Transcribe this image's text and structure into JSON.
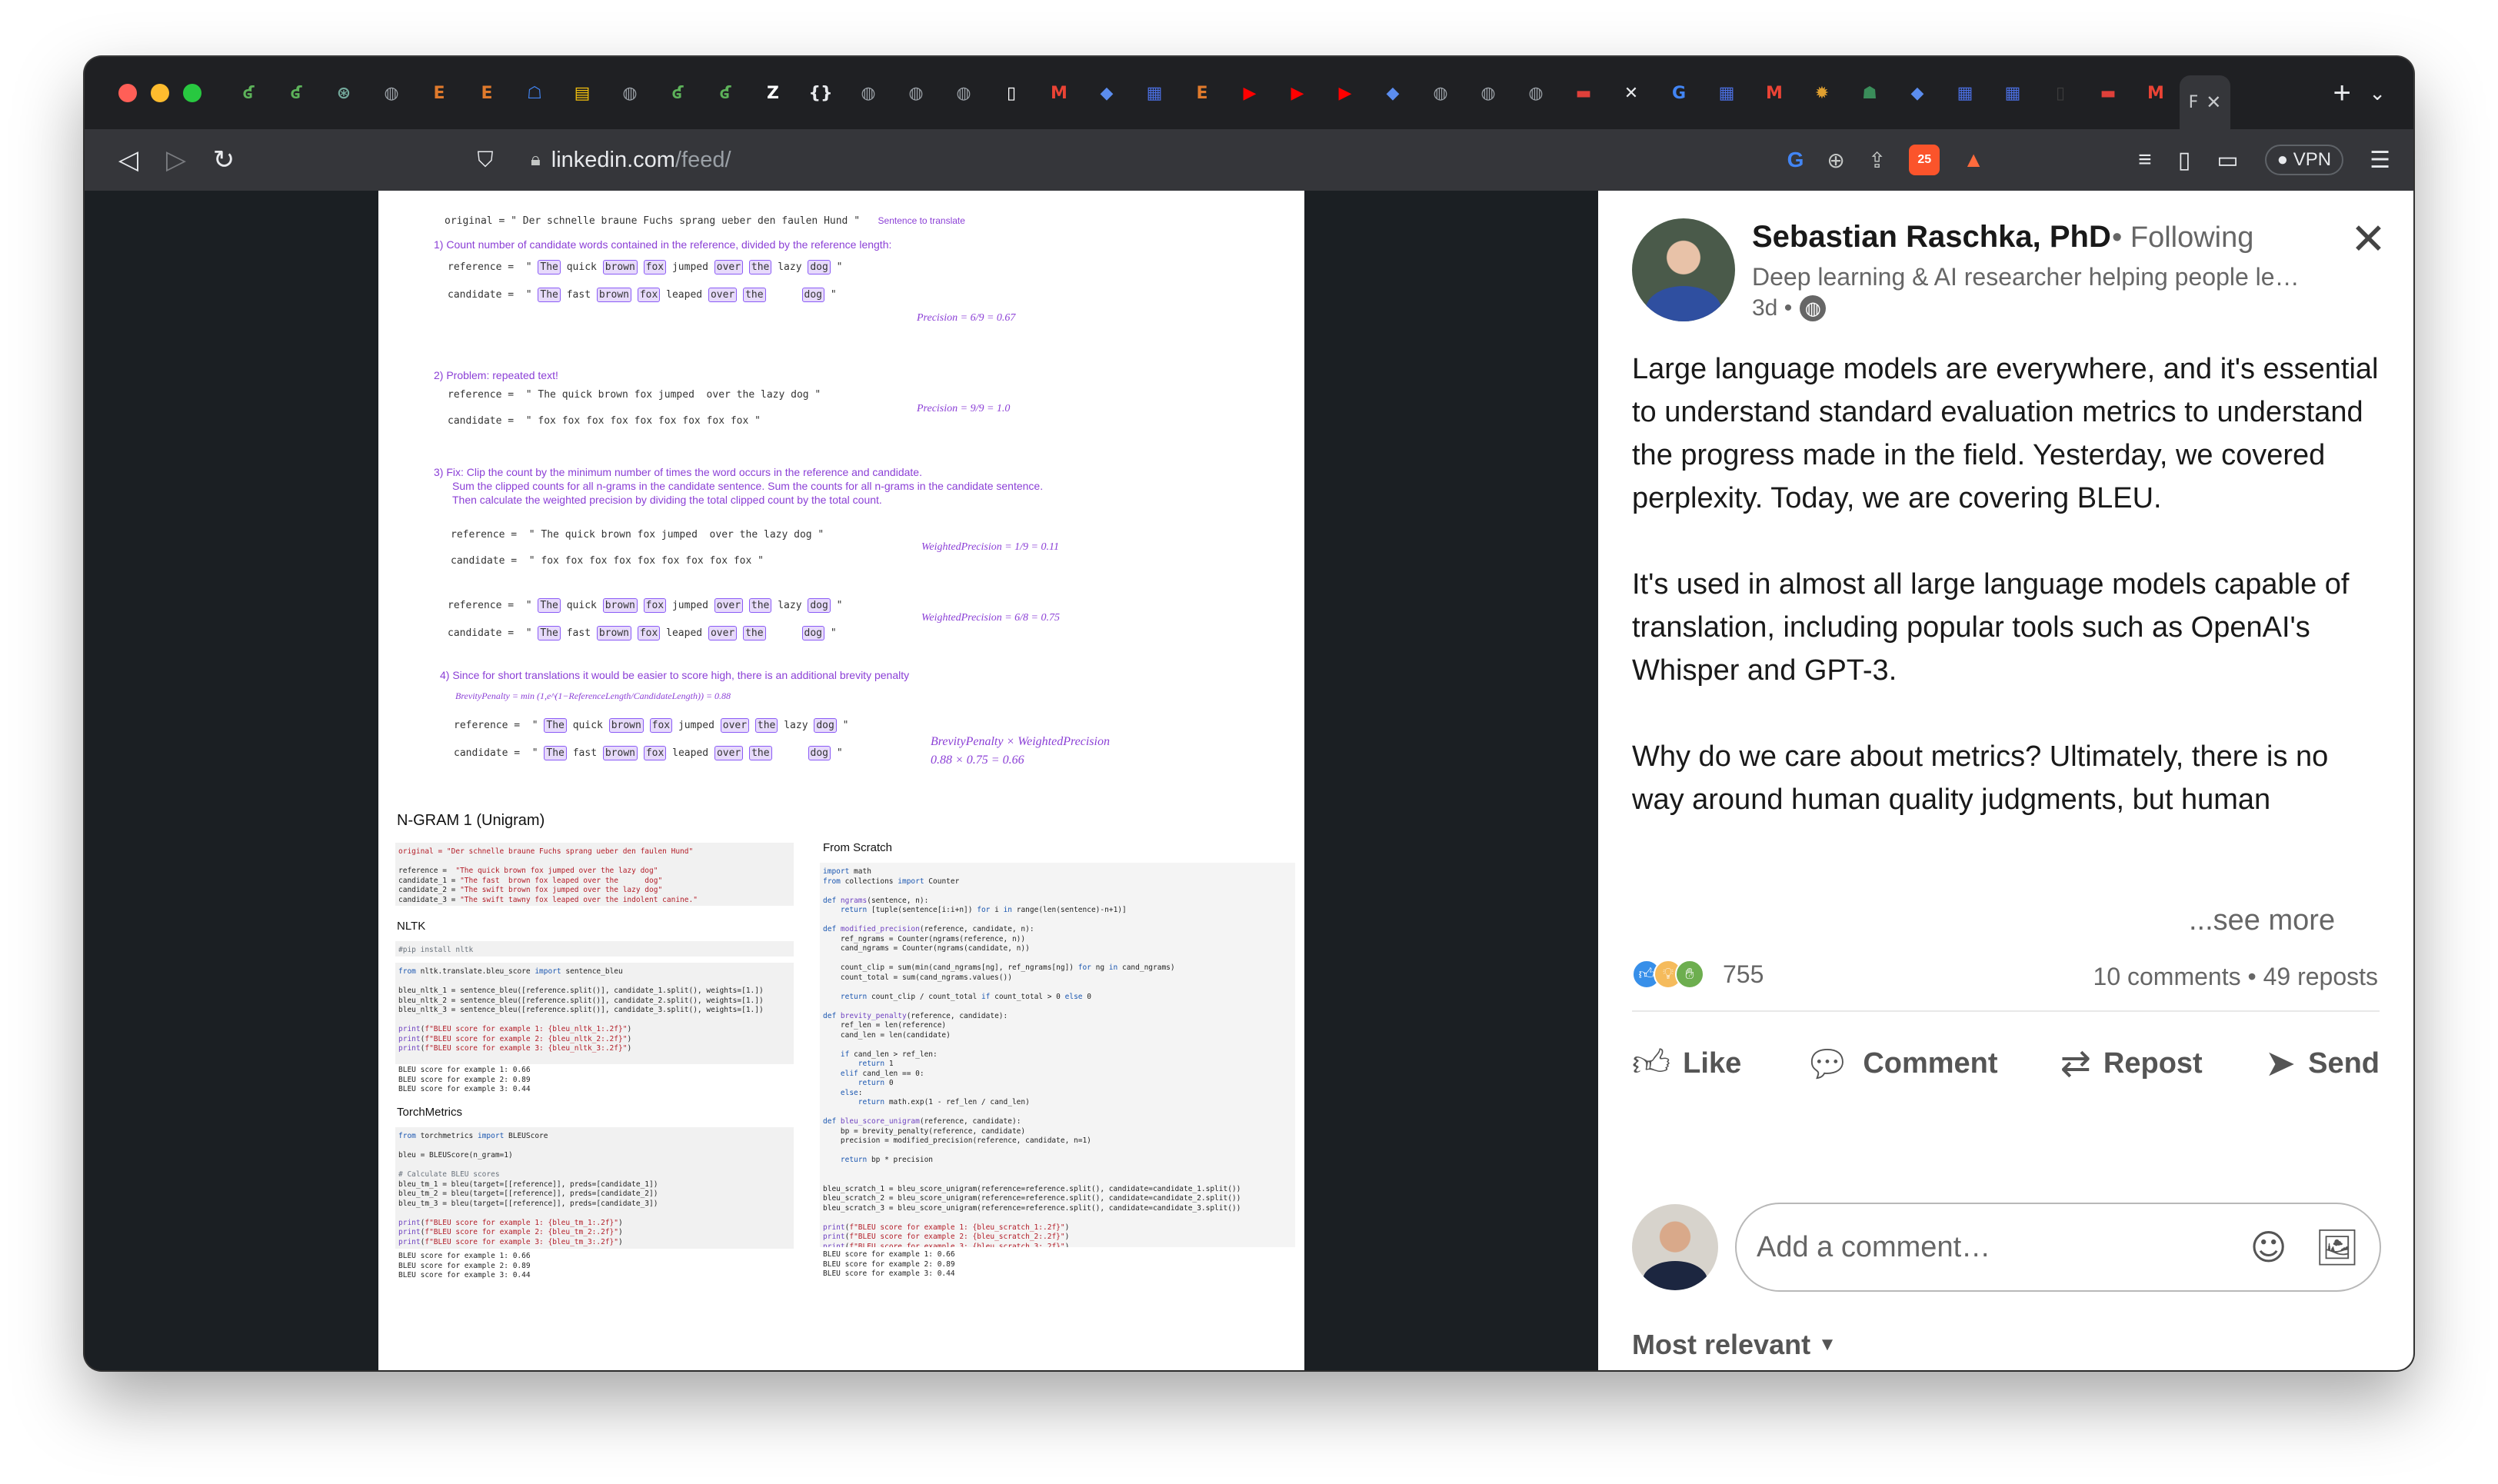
{
  "browser": {
    "tabs": [
      "ʛ",
      "ʛ",
      "⊛",
      "◍",
      "E",
      "E",
      "☖",
      "▤",
      "◍",
      "ʛ",
      "ʛ",
      "Z",
      "{}",
      "◍",
      "◍",
      "◍",
      "▯",
      "M",
      "◆",
      "▦",
      "E",
      "▶",
      "▶",
      "▶",
      "◆",
      "◍",
      "◍",
      "◍",
      "▬",
      "✕",
      "G",
      "▦",
      "M",
      "✹",
      "☗",
      "◆",
      "▦",
      "▦",
      "▯",
      "▬",
      "M"
    ],
    "active_tab_label": "F",
    "url_host": "linkedin.com",
    "url_path": "/feed/",
    "brave_badge": "25",
    "vpn_label": "VPN"
  },
  "figure": {
    "original_line": "original = \" Der schnelle braune Fuchs sprang ueber den faulen Hund \"",
    "original_note": "Sentence to translate",
    "step1": "1) Count number of candidate words contained in the reference, divided by the reference length:",
    "ref_label": "reference =",
    "cand_label": "candidate =",
    "precision1": "Precision = 6/9 = 0.67",
    "step2": "2) Problem: repeated text!",
    "ref_sentence": "\" The quick brown fox jumped  over the lazy dog \"",
    "cand_repeat": "\" fox fox fox fox fox fox fox fox fox \"",
    "precision2": "Precision = 9/9 = 1.0",
    "step3a": "3) Fix: Clip the count by the minimum number of times the word occurs in the reference and candidate.",
    "step3b": "Sum the clipped counts for all n-grams in the candidate sentence. Sum the counts for all n-grams in the candidate sentence.",
    "step3c": "Then calculate the weighted precision by dividing the total clipped count by the total count.",
    "wprec1": "WeightedPrecision = 1/9 = 0.11",
    "wprec2": "WeightedPrecision = 6/8 = 0.75",
    "step4": "4) Since for short translations it would be easier to score high, there is an additional brevity penalty",
    "brevity": "BrevityPenalty = min (1,e^(1−ReferenceLength/CandidateLength)) = 0.88",
    "final1": "BrevityPenalty × WeightedPrecision",
    "final2": "0.88 × 0.75 = 0.66",
    "ngram_title": "N-GRAM 1 (Unigram)",
    "nltk_title": "NLTK",
    "torch_title": "TorchMetrics",
    "scratch_title": "From Scratch",
    "words_ref": [
      "The",
      "quick",
      "brown",
      "fox",
      "jumped",
      "over",
      "the",
      "lazy",
      "dog"
    ],
    "words_cand": [
      "The",
      "fast",
      "brown",
      "fox",
      "leaped",
      "over",
      "the",
      "dog"
    ]
  },
  "post": {
    "author": "Sebastian Raschka, PhD",
    "following": "• Following",
    "headline": "Deep learning & AI researcher helping people learn and use AI",
    "time": "3d •",
    "paragraphs": [
      "Large language models are everywhere, and it's essential to understand standard evaluation metrics to understand the progress made in the field. Yesterday, we covered perplexity. Today, we are covering BLEU.",
      "It's used in almost all large language models capable of translation, including popular tools such as OpenAI's Whisper and GPT-3.",
      "Why do we care about metrics? Ultimately, there is no way around human quality judgments, but human evaluations are tedious, expensive, hard-to-automate, and subjective. Hence, we develop metrics to provide objective summary scores to m"
    ],
    "see_more": "...see more",
    "reaction_count": "755",
    "stats": "10 comments • 49 reposts",
    "actions": {
      "like": "Like",
      "comment": "Comment",
      "repost": "Repost",
      "send": "Send"
    },
    "comment_placeholder": "Add a comment…",
    "sort_label": "Most relevant"
  },
  "colors": {
    "accent_purple": "#8b3fd6",
    "linkedin_text": "#191919",
    "muted": "#666666"
  }
}
